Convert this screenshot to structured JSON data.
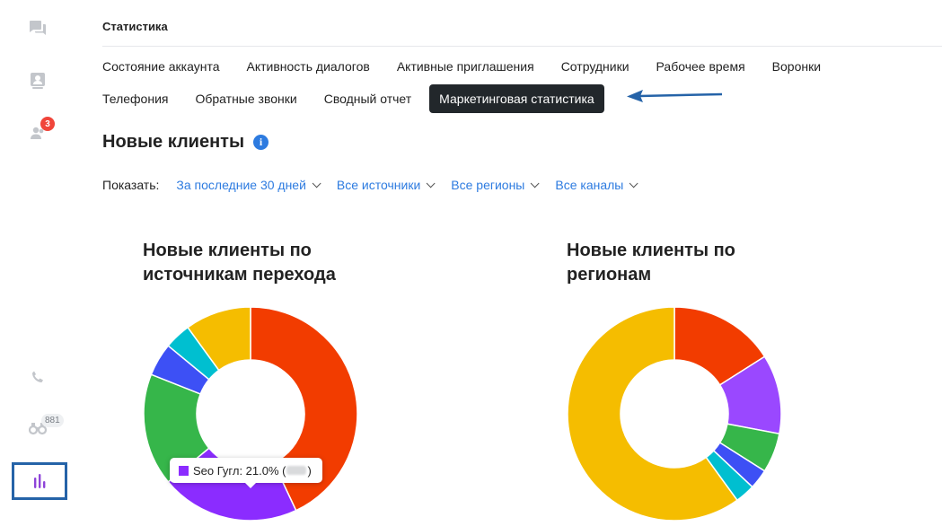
{
  "sidebar": {
    "icons": [
      "chat-icon",
      "contact-card-icon",
      "users-icon",
      "phone-icon",
      "binoculars-icon",
      "bar-chart-icon"
    ],
    "users_badge": "3",
    "binoculars_badge": "881"
  },
  "header": {
    "title": "Статистика"
  },
  "tabs_row1": [
    "Состояние аккаунта",
    "Активность диалогов",
    "Активные приглашения",
    "Сотрудники",
    "Рабочее время",
    "Воронки"
  ],
  "tabs_row2": [
    "Телефония",
    "Обратные звонки",
    "Сводный отчет",
    "Маркетинговая статистика"
  ],
  "active_tab": "Маркетинговая статистика",
  "section": {
    "title": "Новые клиенты",
    "info_icon": "i"
  },
  "filters": {
    "label": "Показать:",
    "period": "За последние 30 дней",
    "sources": "Все источники",
    "regions": "Все регионы",
    "channels": "Все каналы"
  },
  "tooltip": {
    "label": "Seo Гугл: 21.0% (",
    "close": ")",
    "color": "#8b2cff"
  },
  "colors": {
    "accent": "#2d7be0",
    "active_tab_bg": "#22272b",
    "arrow": "#2563a8"
  },
  "chart_data": [
    {
      "type": "pie",
      "title": "Новые клиенты по источникам перехода",
      "values": [
        43,
        21,
        17,
        5,
        4,
        10
      ],
      "colors": [
        "#f23c00",
        "#8b2cff",
        "#36b64a",
        "#3d50f5",
        "#00bfd0",
        "#f5bd00"
      ],
      "labels": [
        "",
        "Seo Гугл",
        "",
        "",
        "",
        ""
      ]
    },
    {
      "type": "pie",
      "title": "Новые клиенты по регионам",
      "values": [
        16,
        12,
        6,
        3,
        3,
        60
      ],
      "colors": [
        "#f23c00",
        "#9a48ff",
        "#36b64a",
        "#3d50f5",
        "#00bfd0",
        "#f5bd00"
      ]
    }
  ]
}
